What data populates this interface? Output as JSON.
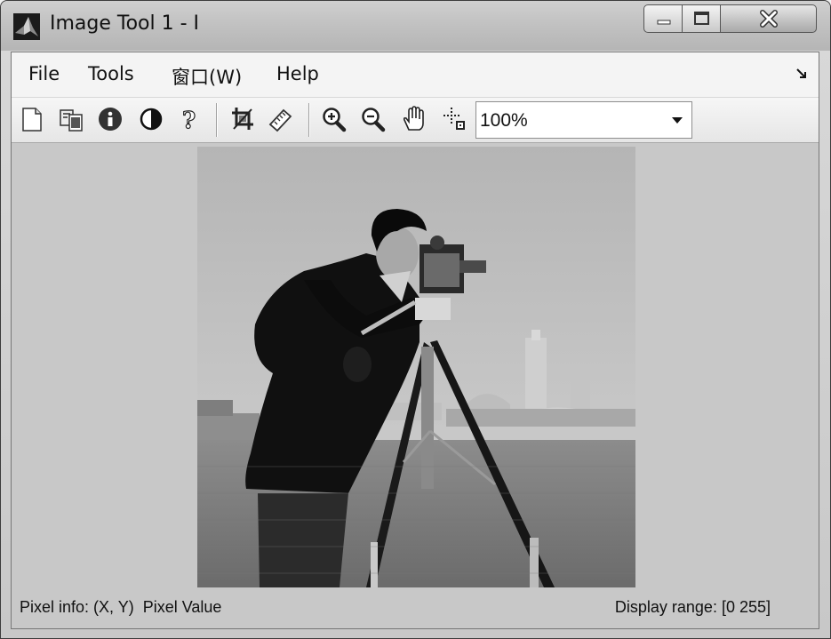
{
  "window": {
    "title": "Image Tool 1 - I",
    "app_icon": "matlab-icon"
  },
  "window_controls": {
    "minimize": "minimize-icon",
    "maximize": "maximize-icon",
    "close": "close-icon"
  },
  "menu": {
    "items": [
      {
        "label": "File"
      },
      {
        "label": "Tools"
      },
      {
        "label": "窗口(W)"
      },
      {
        "label": "Help"
      }
    ],
    "dock_icon": "dock-arrow-icon"
  },
  "toolbar": {
    "buttons": [
      {
        "icon": "new-figure-icon"
      },
      {
        "icon": "export-icon"
      },
      {
        "icon": "image-info-icon"
      },
      {
        "icon": "contrast-icon"
      },
      {
        "icon": "help-icon"
      },
      {
        "icon": "crop-icon"
      },
      {
        "icon": "measure-distance-icon"
      },
      {
        "icon": "zoom-in-icon"
      },
      {
        "icon": "zoom-out-icon"
      },
      {
        "icon": "pan-hand-icon"
      },
      {
        "icon": "pixel-region-icon"
      }
    ],
    "zoom": {
      "value": "100%"
    }
  },
  "image": {
    "description": "grayscale photograph"
  },
  "status": {
    "pixel_info_label": "Pixel info: (X, Y)  Pixel Value",
    "display_range_label": "Display range: [0 255]"
  },
  "colors": {
    "viewport_bg": "#c8c8c8",
    "menubar_bg": "#f4f4f4"
  }
}
